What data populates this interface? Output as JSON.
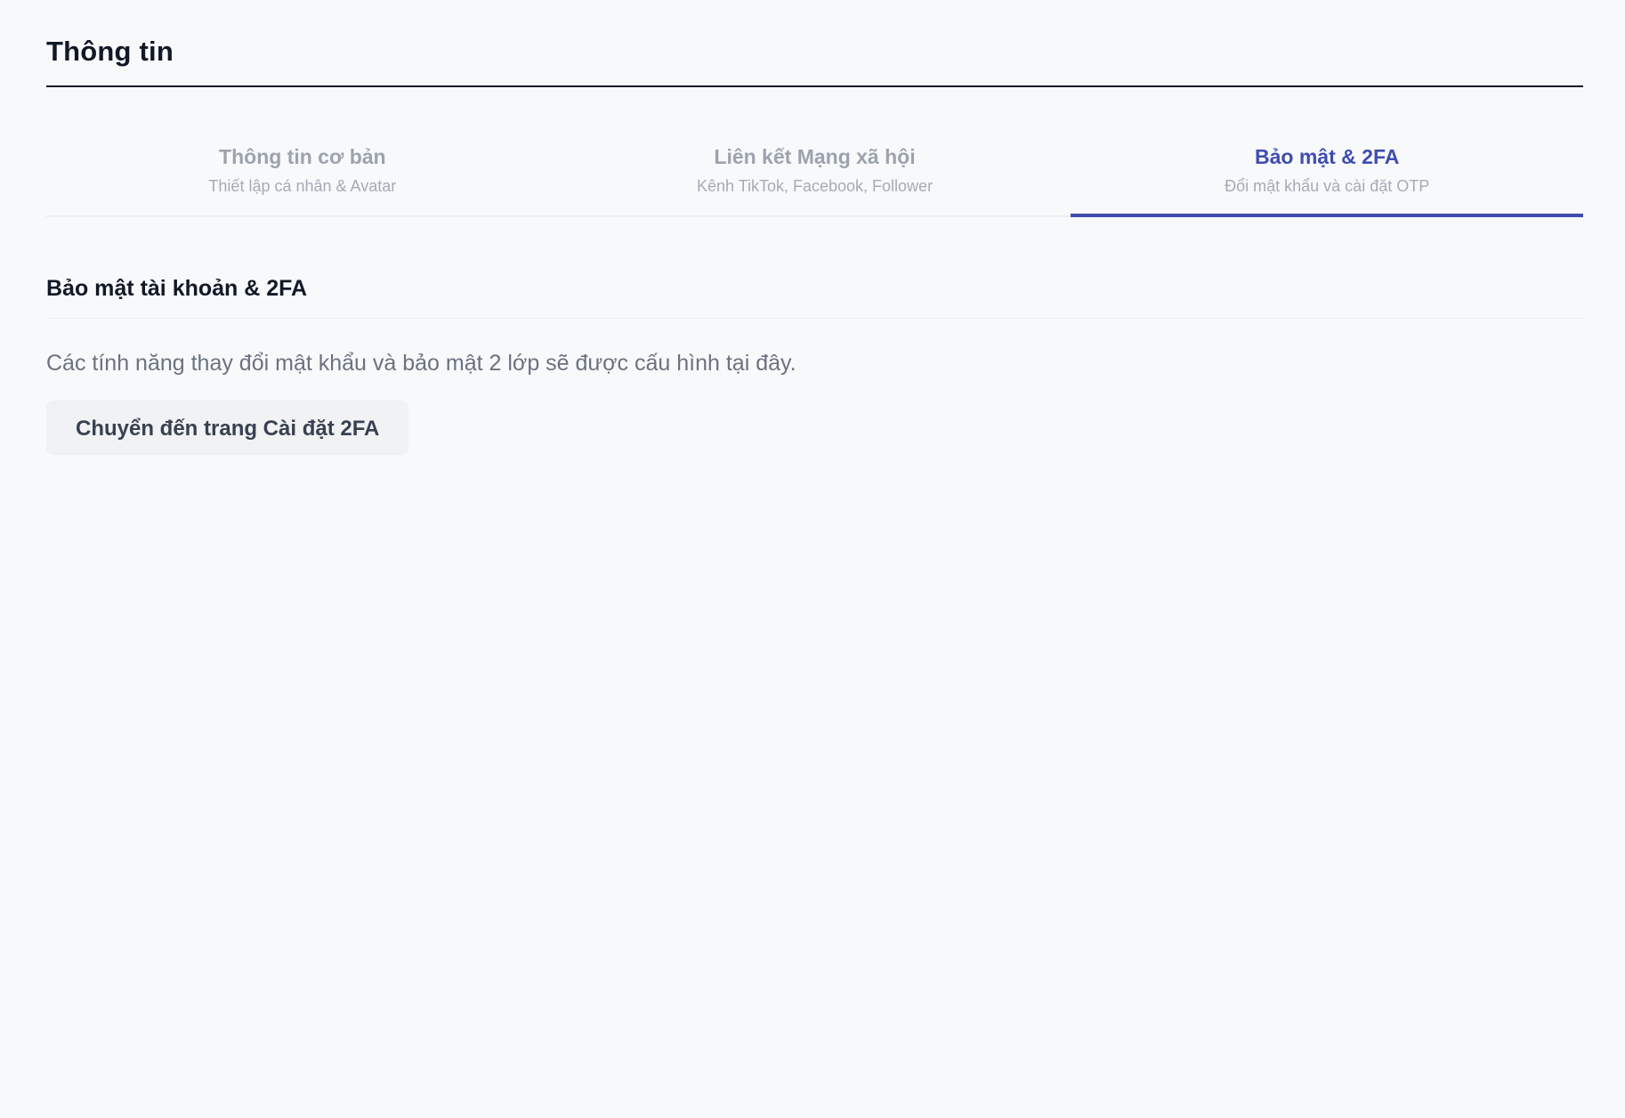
{
  "header": {
    "title": "Thông tin"
  },
  "tabs": [
    {
      "label": "Thông tin cơ bản",
      "subtitle": "Thiết lập cá nhân & Avatar",
      "active": false
    },
    {
      "label": "Liên kết Mạng xã hội",
      "subtitle": "Kênh TikTok, Facebook, Follower",
      "active": false
    },
    {
      "label": "Bảo mật & 2FA",
      "subtitle": "Đổi mật khẩu và cài đặt OTP",
      "active": true
    }
  ],
  "section": {
    "title": "Bảo mật tài khoản & 2FA",
    "description": "Các tính năng thay đổi mật khẩu và bảo mật 2 lớp sẽ được cấu hình tại đây.",
    "button_label": "Chuyển đến trang Cài đặt 2FA"
  },
  "colors": {
    "accent": "#3f4db0",
    "background": "#f8f9fb",
    "muted_text": "#9ca3af"
  }
}
